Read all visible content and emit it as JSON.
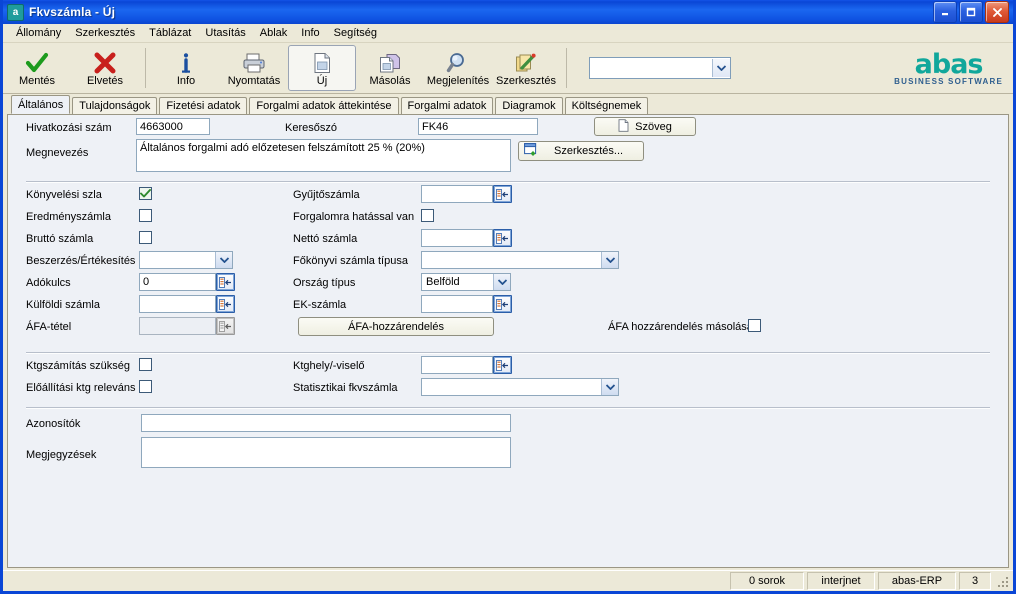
{
  "window": {
    "title": "Fkvszámla - Új",
    "icon": "app-icon",
    "buttons": {
      "minimize": "minimize-icon",
      "maximize": "maximize-icon",
      "close": "close-icon"
    }
  },
  "menu": [
    "Állomány",
    "Szerkesztés",
    "Táblázat",
    "Utasítás",
    "Ablak",
    "Info",
    "Segítség"
  ],
  "toolbar": {
    "items": [
      {
        "label": "Mentés",
        "icon": "checkmark-icon",
        "active": false
      },
      {
        "label": "Elvetés",
        "icon": "cross-icon",
        "active": false
      },
      {
        "label": "Info",
        "icon": "info-icon",
        "active": false
      },
      {
        "label": "Nyomtatás",
        "icon": "printer-icon",
        "active": false
      },
      {
        "label": "Új",
        "icon": "new-document-icon",
        "active": true
      },
      {
        "label": "Másolás",
        "icon": "copy-icon",
        "active": false
      },
      {
        "label": "Megjelenítés",
        "icon": "magnifier-icon",
        "active": false
      },
      {
        "label": "Szerkesztés",
        "icon": "edit-pencil-icon",
        "active": false
      }
    ],
    "command_combo": {
      "value": "",
      "placeholder": ""
    }
  },
  "logo": {
    "name": "abas",
    "tagline": "BUSINESS SOFTWARE",
    "color": "#10a79b"
  },
  "tabs": [
    {
      "label": "Általános",
      "active": true
    },
    {
      "label": "Tulajdonságok",
      "active": false
    },
    {
      "label": "Fizetési adatok",
      "active": false
    },
    {
      "label": "Forgalmi adatok áttekintése",
      "active": false
    },
    {
      "label": "Forgalmi adatok",
      "active": false
    },
    {
      "label": "Diagramok",
      "active": false
    },
    {
      "label": "Költségnemek",
      "active": false
    }
  ],
  "form": {
    "hivatkozasi_szam": {
      "label": "Hivatkozási szám",
      "value": "4663000"
    },
    "kereso_szo": {
      "label": "Keresőszó",
      "value": "FK46"
    },
    "szoveg_button": {
      "label": "Szöveg",
      "icon": "document-icon"
    },
    "megnevezes": {
      "label": "Megnevezés",
      "value": "Általános forgalmi adó előzetesen felszámított 25 % (20%)"
    },
    "szerkesztes_button": {
      "label": "Szerkesztés...",
      "icon": "edit-window-icon"
    },
    "konyvelesi_szla": {
      "label": "Könyvelési szla",
      "checked": true
    },
    "eredmenyszamla": {
      "label": "Eredményszámla",
      "checked": false
    },
    "brutto_szamla": {
      "label": "Bruttó számla",
      "checked": false
    },
    "beszerzes_ertekesites": {
      "label": "Beszerzés/Értékesítés",
      "value": ""
    },
    "adokulcs": {
      "label": "Adókulcs",
      "value": "0"
    },
    "kulfoldi_szamla": {
      "label": "Külföldi számla",
      "value": ""
    },
    "afa_tetel": {
      "label": "ÁFA-tétel",
      "value": "",
      "disabled": true
    },
    "gyujtoszamla": {
      "label": "Gyűjtőszámla",
      "value": ""
    },
    "forgalomra_hatassal_van": {
      "label": "Forgalomra hatással van",
      "checked": false
    },
    "netto_szamla": {
      "label": "Nettó számla",
      "value": ""
    },
    "fokonyvi_szamla_tipusa": {
      "label": "Főkönyvi számla típusa",
      "value": ""
    },
    "orszag_tipus": {
      "label": "Ország típus",
      "value": "Belföld"
    },
    "ek_szamla": {
      "label": "EK-számla",
      "value": ""
    },
    "afa_hozzarendeles_button": {
      "label": "ÁFA-hozzárendelés"
    },
    "afa_hozzarendeles_masolasa": {
      "label": "ÁFA hozzárendelés másolása",
      "checked": false
    },
    "ktgszamitas_szukseg": {
      "label": "Ktgszámítás szükség",
      "checked": false
    },
    "eloallitasi_ktg_relevans": {
      "label": "Előállítási ktg releváns",
      "checked": false
    },
    "ktghely_viselo": {
      "label": "Ktghely/-viselő",
      "value": ""
    },
    "statisztikai_fkvszamla": {
      "label": "Statisztikai fkvszámla",
      "value": ""
    },
    "azonositok": {
      "label": "Azonosítók",
      "value": ""
    },
    "megjegyzesek": {
      "label": "Megjegyzések",
      "value": ""
    }
  },
  "statusbar": {
    "rows": "0 sorok",
    "user": "interjnet",
    "system": "abas-ERP",
    "count": "3"
  }
}
